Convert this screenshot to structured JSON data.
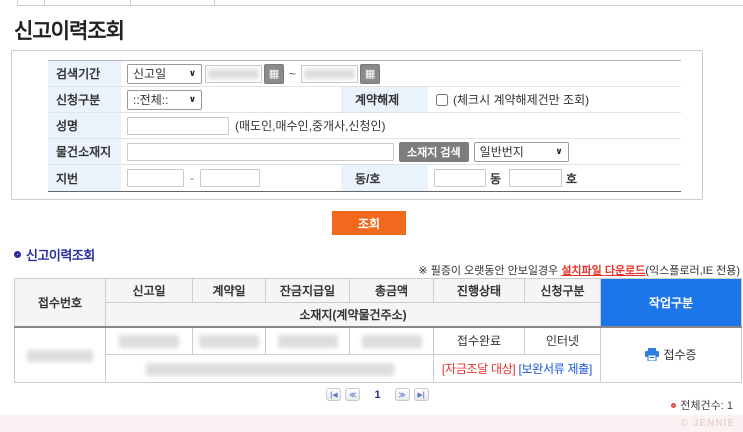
{
  "colors": {
    "accent_orange": "#f2691d",
    "header_blue": "#1d76e8",
    "section_navy": "#2b2fa0",
    "alert_red": "#e8332a",
    "link_blue": "#1a56d6"
  },
  "icons": {
    "calendar": "▦",
    "caret": "∨"
  },
  "page": {
    "title": "신고이력조회",
    "footer_watermark": "© JENNIE"
  },
  "search_form": {
    "period": {
      "label": "검색기간",
      "type_selected": "신고일",
      "range_separator": "~"
    },
    "apply_type": {
      "label": "신청구분",
      "selected": "::전체::"
    },
    "contract_cancel": {
      "label": "계약해제",
      "checkbox_text": "(체크시 계약해제건만 조회)"
    },
    "name": {
      "label": "성명",
      "hint": "(매도인,매수인,중개사,신청인)"
    },
    "location": {
      "label": "물건소재지",
      "search_button": "소재지 검색",
      "lot_type_selected": "일반번지"
    },
    "lot": {
      "label": "지번",
      "dash": "-",
      "dong_ho_label": "동/호",
      "dong_suffix": "동",
      "ho_suffix": "호"
    },
    "submit_button": "조회"
  },
  "results": {
    "section_title": "신고이력조회",
    "notice_prefix": "※ 필증이 오랫동안 안보일경우 ",
    "notice_link": "설치파일 다운로드",
    "notice_suffix": "(익스플로러,IE 전용)",
    "table": {
      "col_receipt_no": "접수번호",
      "col_report_date": "신고일",
      "col_contract_date": "계약일",
      "col_balance_date": "잔금지급일",
      "col_total_amount": "총금액",
      "col_status": "진행상태",
      "col_apply_type": "신청구분",
      "col_address": "소재지(계약물건주소)",
      "col_actions": "작업구분",
      "row": {
        "status": "접수완료",
        "apply_type": "인터넷",
        "tag_funding": "[자금조달 대상]",
        "tag_docs": "[보완서류 제출]",
        "receipt_doc": "접수증"
      }
    },
    "pagination": {
      "first": "|◀",
      "prev": "≪",
      "current": "1",
      "next": "≫",
      "last": "▶|"
    },
    "total_count": "전체건수: 1"
  }
}
